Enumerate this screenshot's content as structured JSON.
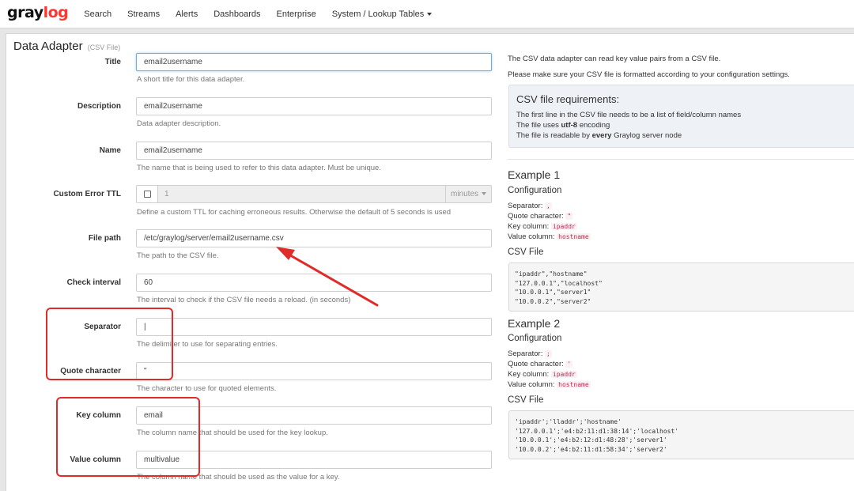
{
  "nav": {
    "logo_gray": "gray",
    "logo_accent": "log",
    "items": [
      "Search",
      "Streams",
      "Alerts",
      "Dashboards",
      "Enterprise",
      "System / Lookup Tables"
    ]
  },
  "page": {
    "title": "Data Adapter",
    "subtitle": "(CSV File)"
  },
  "form": {
    "title": {
      "label": "Title",
      "value": "email2username",
      "help": "A short title for this data adapter."
    },
    "description": {
      "label": "Description",
      "value": "email2username",
      "help": "Data adapter description."
    },
    "name": {
      "label": "Name",
      "value": "email2username",
      "help": "The name that is being used to refer to this data adapter. Must be unique."
    },
    "ttl": {
      "label": "Custom Error TTL",
      "value": "1",
      "unit": "minutes",
      "help": "Define a custom TTL for caching erroneous results. Otherwise the default of 5 seconds is used"
    },
    "file_path": {
      "label": "File path",
      "value": "/etc/graylog/server/email2username.csv",
      "help": "The path to the CSV file."
    },
    "check_interval": {
      "label": "Check interval",
      "value": "60",
      "help": "The interval to check if the CSV file needs a reload. (in seconds)"
    },
    "separator": {
      "label": "Separator",
      "value": "|",
      "help": "The delimiter to use for separating entries."
    },
    "quote_char": {
      "label": "Quote character",
      "value": "\"",
      "help": "The character to use for quoted elements."
    },
    "key_column": {
      "label": "Key column",
      "value": "email",
      "help": "The column name that should be used for the key lookup."
    },
    "value_column": {
      "label": "Value column",
      "value": "multivalue",
      "help": "The column name that should be used as the value for a key."
    }
  },
  "info": {
    "p1": "The CSV data adapter can read key value pairs from a CSV file.",
    "p2": "Please make sure your CSV file is formatted according to your configuration settings.",
    "req_title": "CSV file requirements:",
    "req1": "The first line in the CSV file needs to be a list of field/column names",
    "req2_a": "The file uses ",
    "req2_b": "utf-8",
    "req2_c": " encoding",
    "req3_a": "The file is readable by ",
    "req3_b": "every",
    "req3_c": " Graylog server node"
  },
  "examples": {
    "labels": {
      "config": "Configuration",
      "csv": "CSV File",
      "sep": "Separator:",
      "quote": "Quote character:",
      "key": "Key column:",
      "val": "Value column:"
    },
    "ex1": {
      "title": "Example 1",
      "sep": ",",
      "quote": "\"",
      "key": "ipaddr",
      "val": "hostname",
      "lines": [
        "\"ipaddr\",\"hostname\"",
        "\"127.0.0.1\",\"localhost\"",
        "\"10.0.0.1\",\"server1\"",
        "\"10.0.0.2\",\"server2\""
      ]
    },
    "ex2": {
      "title": "Example 2",
      "sep": ";",
      "quote": "'",
      "key": "ipaddr",
      "val": "hostname",
      "lines": [
        "'ipaddr';'lladdr';'hostname'",
        "'127.0.0.1';'e4:b2:11:d1:38:14';'localhost'",
        "'10.0.0.1';'e4:b2:12:d1:48:28';'server1'",
        "'10.0.0.2';'e4:b2:11:d1:58:34';'server2'"
      ]
    }
  },
  "colors": {
    "accent": "#ff3633",
    "annotation": "#e02b2b"
  }
}
